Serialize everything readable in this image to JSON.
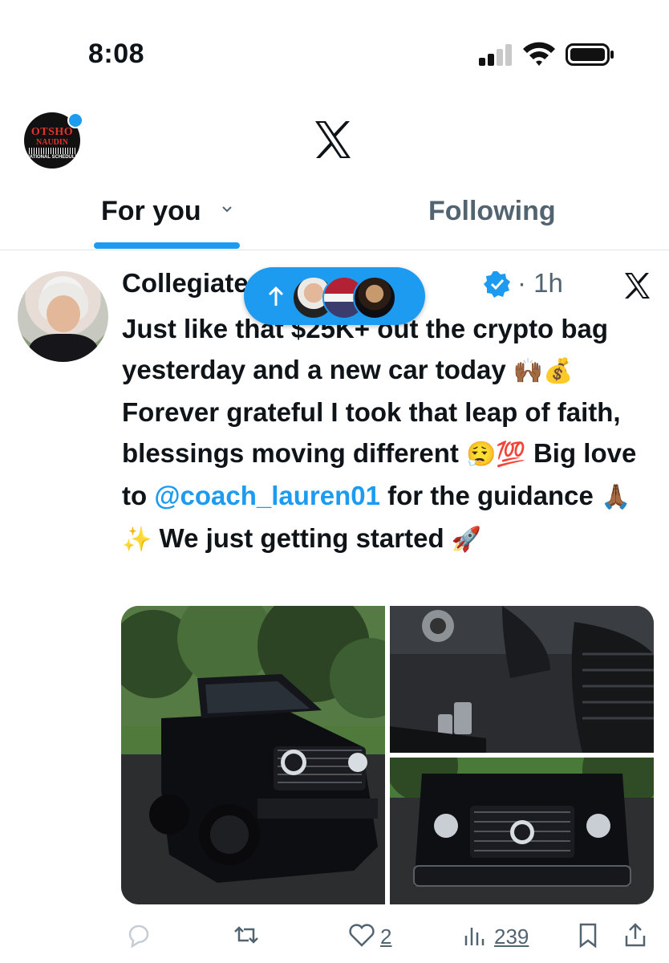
{
  "status_bar": {
    "time": "8:08"
  },
  "header": {
    "brand_top": "OTSHO",
    "brand_mid": "NAUDIN",
    "brand_bottom": "NATIONAL SCHEDULE"
  },
  "tabs": [
    {
      "label": "For you",
      "active": true
    },
    {
      "label": "Following",
      "active": false
    }
  ],
  "post": {
    "author": "Collegiate Athlete Adv...",
    "time": "· 1h",
    "text_part1": "Just like that $25K+ out the crypto bag yesterday and a new car today ",
    "emoji1": "🙌🏾💰",
    "text_part2": " Forever grateful I took that leap of faith, blessings moving different ",
    "emoji2": "😮‍💨💯",
    "text_part3": " Big love to ",
    "mention": "@coach_lauren01",
    "text_part4": " for the guidance ",
    "emoji3": "🙏🏾✨",
    "text_part5": " We just getting started ",
    "emoji4": "🚀"
  },
  "actions": {
    "reply_count": "",
    "retweet_count": "",
    "like_count": "2",
    "views_count": "239"
  },
  "colors": {
    "accent": "#1d9bf0",
    "text": "#0f1419",
    "muted": "#536471"
  }
}
